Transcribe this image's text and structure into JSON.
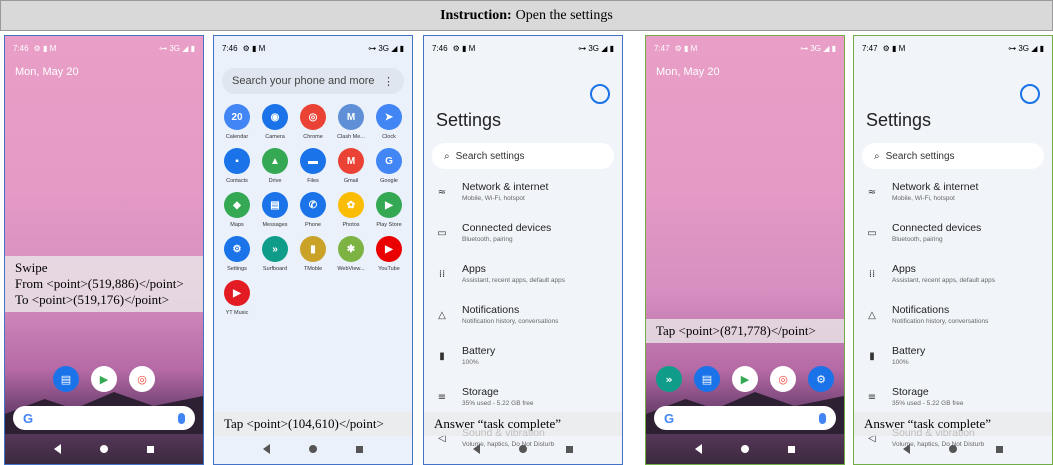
{
  "instruction": {
    "prefix": "Instruction:",
    "text": "Open the settings"
  },
  "panels": {
    "p1": {
      "time": "7:46",
      "signal": "3G",
      "date": "Mon, May 20",
      "action_line1": "Swipe",
      "action_line2": "From <point>(519,886)</point>",
      "action_line3": "To <point>(519,176)</point>"
    },
    "p2": {
      "time": "7:46",
      "signal": "3G",
      "search_placeholder": "Search your phone and more",
      "apps": [
        {
          "label": "Calendar",
          "glyph": "20",
          "color": "#4285f4"
        },
        {
          "label": "Camera",
          "glyph": "◉",
          "color": "#1a73e8"
        },
        {
          "label": "Chrome",
          "glyph": "◎",
          "color": "#ea4335"
        },
        {
          "label": "Clash Me...",
          "glyph": "M",
          "color": "#5f8fd6"
        },
        {
          "label": "Clock",
          "glyph": "➤",
          "color": "#4285f4"
        },
        {
          "label": "Contacts",
          "glyph": "▪",
          "color": "#1a73e8"
        },
        {
          "label": "Drive",
          "glyph": "▲",
          "color": "#34a853"
        },
        {
          "label": "Files",
          "glyph": "▬",
          "color": "#1a73e8"
        },
        {
          "label": "Gmail",
          "glyph": "M",
          "color": "#ea4335"
        },
        {
          "label": "Google",
          "glyph": "G",
          "color": "#4285f4"
        },
        {
          "label": "Maps",
          "glyph": "◆",
          "color": "#34a853"
        },
        {
          "label": "Messages",
          "glyph": "▤",
          "color": "#1a73e8"
        },
        {
          "label": "Phone",
          "glyph": "✆",
          "color": "#1a73e8"
        },
        {
          "label": "Photos",
          "glyph": "✿",
          "color": "#fbbc04"
        },
        {
          "label": "Play Store",
          "glyph": "▶",
          "color": "#34a853"
        },
        {
          "label": "Settings",
          "glyph": "⚙",
          "color": "#1a73e8"
        },
        {
          "label": "Surfboard",
          "glyph": "»",
          "color": "#0f9d8a"
        },
        {
          "label": "TMoble",
          "glyph": "▮",
          "color": "#c9a227"
        },
        {
          "label": "WebView...",
          "glyph": "✱",
          "color": "#7cb342"
        },
        {
          "label": "YouTube",
          "glyph": "▶",
          "color": "#ea0000"
        },
        {
          "label": "YT Music",
          "glyph": "▶",
          "color": "#e31b23"
        }
      ],
      "action": "Tap <point>(104,610)</point>"
    },
    "p3": {
      "time": "7:46",
      "signal": "3G",
      "action": "Answer “task complete”"
    },
    "p4": {
      "time": "7:47",
      "signal": "3G",
      "date": "Mon, May 20",
      "action": "Tap <point>(871,778)</point>"
    },
    "p5": {
      "time": "7:47",
      "signal": "3G",
      "action": "Answer “task complete”"
    }
  },
  "settings": {
    "title": "Settings",
    "search": "Search settings",
    "items": [
      {
        "icon": "wifi-icon",
        "glyph": "≈",
        "title": "Network & internet",
        "sub": "Mobile, Wi-Fi, hotspot"
      },
      {
        "icon": "devices-icon",
        "glyph": "▭",
        "title": "Connected devices",
        "sub": "Bluetooth, pairing"
      },
      {
        "icon": "apps-icon",
        "glyph": "⁞⁞",
        "title": "Apps",
        "sub": "Assistant, recent apps, default apps"
      },
      {
        "icon": "bell-icon",
        "glyph": "△",
        "title": "Notifications",
        "sub": "Notification history, conversations"
      },
      {
        "icon": "battery-icon",
        "glyph": "▮",
        "title": "Battery",
        "sub": "100%"
      },
      {
        "icon": "storage-icon",
        "glyph": "≡",
        "title": "Storage",
        "sub": "35% used - 5.22 GB free"
      },
      {
        "icon": "sound-icon",
        "glyph": "◁",
        "title": "Sound & vibration",
        "sub": "Volume, haptics, Do Not Disturb"
      }
    ]
  }
}
